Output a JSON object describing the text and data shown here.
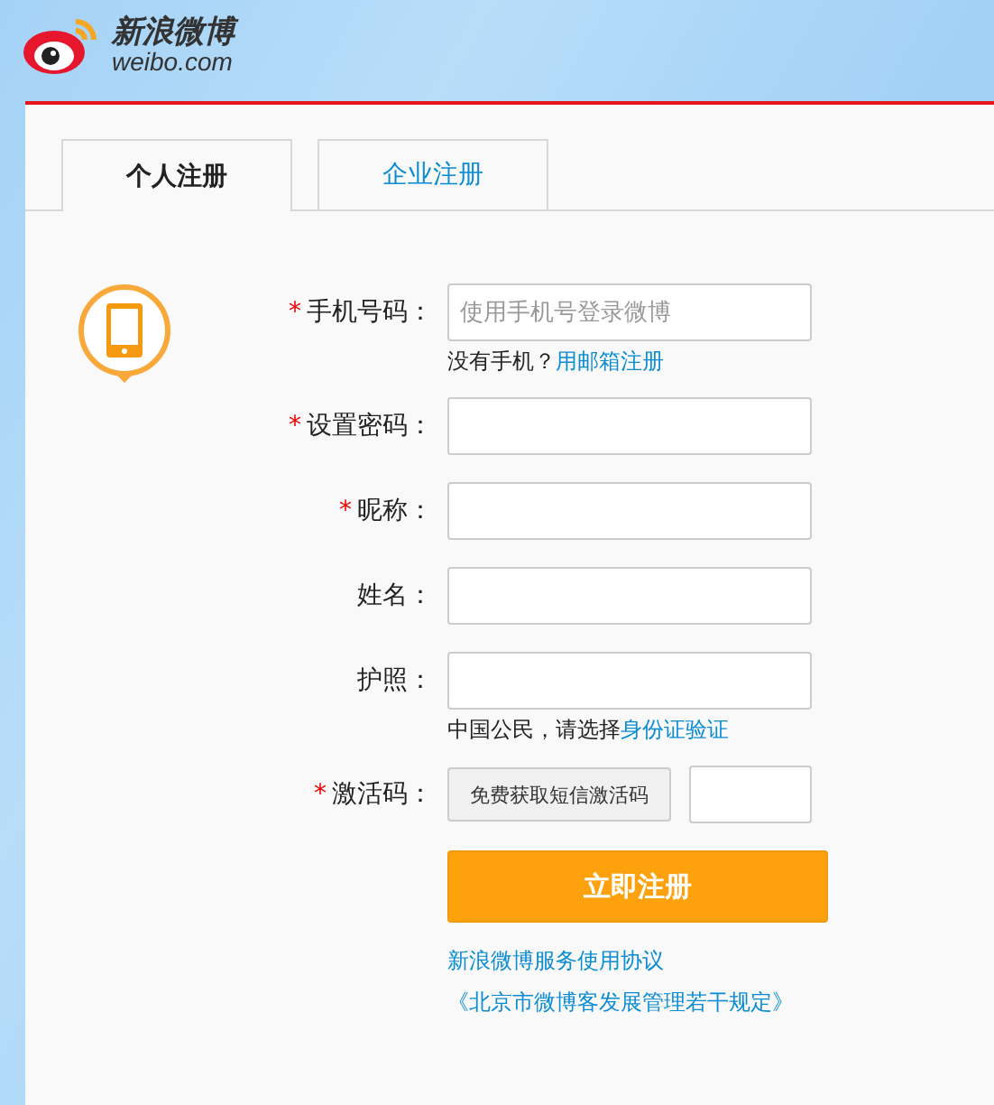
{
  "logo": {
    "name": "新浪微博",
    "domain": "weibo.com"
  },
  "tabs": [
    {
      "label": "个人注册",
      "selected": true
    },
    {
      "label": "企业注册",
      "selected": false
    }
  ],
  "fields": [
    {
      "kind": "input",
      "marker": "*",
      "label": "手机号码：",
      "placeholder": "使用手机号登录微博",
      "hint": {
        "text": "没有手机？",
        "link": "用邮箱注册"
      }
    },
    {
      "kind": "input",
      "marker": "*",
      "label": "设置密码："
    },
    {
      "kind": "input",
      "marker": "*",
      "label": "昵称："
    },
    {
      "kind": "input",
      "label": "姓名："
    },
    {
      "kind": "input",
      "label": "护照：",
      "hint": {
        "text": "中国公民，请选择",
        "link": "身份证验证"
      }
    },
    {
      "kind": "code",
      "marker": "*",
      "label": "激活码：",
      "button": "免费获取短信激活码"
    }
  ],
  "submit": "立即注册",
  "links": [
    "新浪微博服务使用协议",
    "《北京市微博客发展管理若干规定》"
  ]
}
